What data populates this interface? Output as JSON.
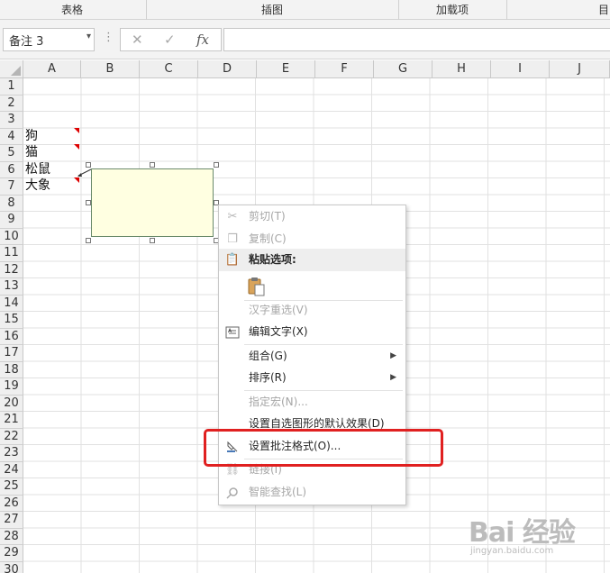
{
  "ribbon": {
    "groups": [
      "表格",
      "插图",
      "加载项"
    ],
    "edge_text": "目"
  },
  "formula_bar": {
    "name_box": "备注 3",
    "cancel_glyph": "✕",
    "enter_glyph": "✓",
    "fx_glyph": "fx",
    "formula_value": ""
  },
  "columns": [
    "A",
    "B",
    "C",
    "D",
    "E",
    "F",
    "G",
    "H",
    "I",
    "J"
  ],
  "rows": [
    "1",
    "2",
    "3",
    "4",
    "5",
    "6",
    "7",
    "8",
    "9",
    "10",
    "11",
    "12",
    "13",
    "14",
    "15",
    "16",
    "17",
    "18",
    "19",
    "20",
    "21",
    "22",
    "23",
    "24",
    "25",
    "26",
    "27",
    "28",
    "29",
    "30"
  ],
  "cells": {
    "A4": "狗",
    "A5": "猫",
    "A6": "松鼠",
    "A7": "大象"
  },
  "context_menu": {
    "items": [
      {
        "label": "剪切(T)",
        "icon": "scissors-icon",
        "disabled": true
      },
      {
        "label": "复制(C)",
        "icon": "copy-icon",
        "disabled": true
      },
      {
        "label": "粘贴选项:",
        "icon": "clipboard-icon",
        "disabled": false
      },
      {
        "label": "汉字重选(V)",
        "icon": "",
        "disabled": true
      },
      {
        "label": "编辑文字(X)",
        "icon": "edit-text-icon",
        "disabled": false
      },
      {
        "label": "组合(G)",
        "icon": "",
        "disabled": false,
        "submenu": true
      },
      {
        "label": "排序(R)",
        "icon": "",
        "disabled": false,
        "submenu": true
      },
      {
        "label": "指定宏(N)...",
        "icon": "",
        "disabled": true
      },
      {
        "label": "设置自选图形的默认效果(D)",
        "icon": "",
        "disabled": false
      },
      {
        "label": "设置批注格式(O)...",
        "icon": "format-comment-icon",
        "disabled": false
      },
      {
        "label": "链接(I)",
        "icon": "link-icon",
        "disabled": true
      },
      {
        "label": "智能查找(L)",
        "icon": "smart-lookup-icon",
        "disabled": true
      }
    ]
  },
  "colors": {
    "highlight": "#e02020",
    "comment_fill": "#ffffe1",
    "comment_marker": "#dd0000"
  },
  "watermark": {
    "main": "Bai 经验",
    "sub": "jingyan.baidu.com"
  }
}
